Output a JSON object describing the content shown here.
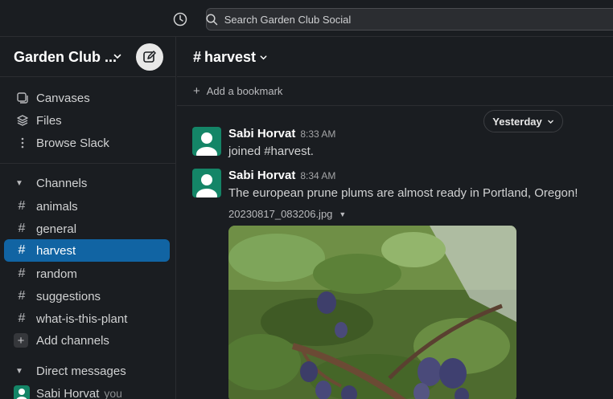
{
  "topbar": {
    "search_placeholder": "Search Garden Club Social"
  },
  "sidebar": {
    "workspace_name": "Garden Club ...",
    "nav": [
      {
        "label": "Canvases",
        "icon": "canvas-icon"
      },
      {
        "label": "Files",
        "icon": "files-stack-icon"
      },
      {
        "label": "Browse Slack",
        "icon": "more-vertical-icon"
      }
    ],
    "channels_section": "Channels",
    "channels": [
      "animals",
      "general",
      "harvest",
      "random",
      "suggestions",
      "what-is-this-plant"
    ],
    "active_channel": "harvest",
    "add_channels": "Add channels",
    "dm_section": "Direct messages",
    "dm_user": "Sabi Horvat",
    "dm_you": "you"
  },
  "main": {
    "channel_title": "harvest",
    "bookmark_label": "Add a bookmark",
    "date_divider": "Yesterday",
    "messages": [
      {
        "sender": "Sabi Horvat",
        "time": "8:33 AM",
        "text": "joined #harvest."
      },
      {
        "sender": "Sabi Horvat",
        "time": "8:34 AM",
        "text": "The european prune plums are almost ready in Portland, Oregon!"
      }
    ],
    "attachment_name": "20230817_083206.jpg"
  },
  "colors": {
    "active_channel_bg": "#1164a3",
    "avatar_bg": "#148567",
    "app_bg": "#1a1d21"
  }
}
